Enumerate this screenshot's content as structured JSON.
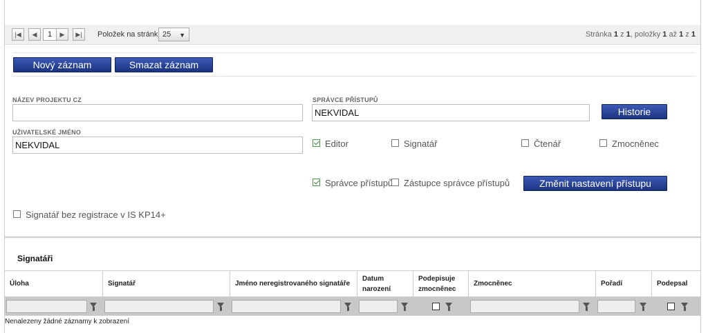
{
  "pager": {
    "first_icon": "first-page-icon",
    "prev_icon": "prev-page-icon",
    "page_number": "1",
    "next_icon": "next-page-icon",
    "last_icon": "last-page-icon",
    "items_per_page_label": "Položek na stránku",
    "items_per_page_value": "25",
    "info_parts": [
      "Stránka ",
      "1",
      " z ",
      "1",
      ", položky ",
      "1",
      " až ",
      "1",
      " z ",
      "1"
    ]
  },
  "toolbar": {
    "new_record_label": "Nový záznam",
    "delete_record_label": "Smazat záznam"
  },
  "form": {
    "project_name_label": "NÁZEV PROJEKTU CZ",
    "project_name_value": "",
    "access_admin_label": "SPRÁVCE PŘÍSTUPŮ",
    "access_admin_value": "NEKVIDAL",
    "history_button": "Historie",
    "username_label": "UŽIVATELSKÉ JMÉNO",
    "username_value": "NEKVIDAL",
    "roles": [
      {
        "label": "Editor",
        "checked": true
      },
      {
        "label": "Signatář",
        "checked": false
      },
      {
        "label": "Čtenář",
        "checked": false
      },
      {
        "label": "Zmocněnec",
        "checked": false
      }
    ],
    "admin_checkbox": {
      "label": "Správce přístupů",
      "checked": true
    },
    "deputy_checkbox": {
      "label": "Zástupce správce přístupů",
      "checked": false
    },
    "change_access_button": "Změnit nastavení přístupu",
    "unregistered_signatory": {
      "label": "Signatář bez registrace v IS KP14+",
      "checked": false
    }
  },
  "signatories": {
    "title": "Signatáři",
    "columns": [
      "Úloha",
      "Signatář",
      "Jméno neregistrovaného signatáře",
      "Datum narození",
      "Podepisuje zmocněnec",
      "Zmocněnec",
      "Pořadí",
      "Podepsal"
    ],
    "column_lines": [
      [
        "Úloha"
      ],
      [
        "Signatář"
      ],
      [
        "Jméno neregistrovaného signatáře"
      ],
      [
        "Datum",
        "narození"
      ],
      [
        "Podepisuje",
        "zmocněnec"
      ],
      [
        "Zmocněnec"
      ],
      [
        "Pořadí"
      ],
      [
        "Podepsal"
      ]
    ],
    "filter_icon": "funnel-filter-icon",
    "empty_message": "Nenalezeny žádné záznamy k zobrazení"
  },
  "colors": {
    "button_blue": "#1c3480",
    "check_green": "#3a8a3a",
    "filter_row_bg": "#c8c8c8"
  }
}
